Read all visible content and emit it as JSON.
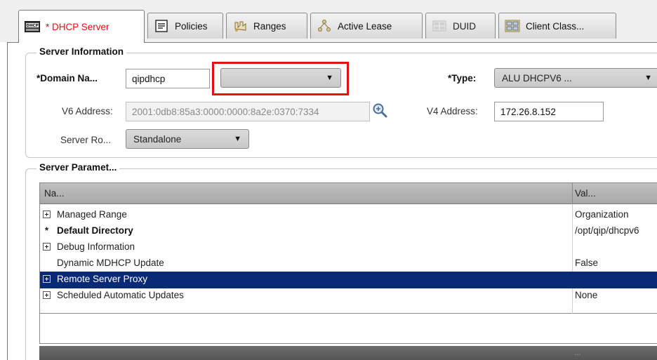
{
  "tabs": [
    {
      "id": "dhcp-server",
      "label": "* DHCP Server",
      "icon": "dhcp-server-icon",
      "active": true
    },
    {
      "id": "policies",
      "label": "Policies",
      "icon": "policies-icon"
    },
    {
      "id": "ranges",
      "label": "Ranges",
      "icon": "ranges-icon"
    },
    {
      "id": "active-lease",
      "label": "Active Lease",
      "icon": "active-lease-icon"
    },
    {
      "id": "duid",
      "label": "DUID",
      "icon": "duid-icon",
      "disabled": true
    },
    {
      "id": "client-class",
      "label": "Client Class...",
      "icon": "client-class-icon"
    }
  ],
  "server_info": {
    "title": "Server Information",
    "domain_label": "*Domain Na...",
    "domain_value": "qipdhcp",
    "domain_combo_value": "",
    "type_label": "*Type:",
    "type_value": "ALU DHCPV6 ...",
    "v6_label": "V6 Address:",
    "v6_value": "2001:0db8:85a3:0000:0000:8a2e:0370:7334",
    "v4_label": "V4 Address:",
    "v4_value": "172.26.8.152",
    "role_label": "Server Ro...",
    "role_value": "Standalone"
  },
  "server_params": {
    "title": "Server Paramet...",
    "columns": [
      "Na...",
      "Val..."
    ],
    "rows": [
      {
        "marker": "expand",
        "name": "Managed Range",
        "value": "Organization",
        "bold": false,
        "selected": false
      },
      {
        "marker": "star",
        "name": "Default Directory",
        "value": "/opt/qip/dhcpv6",
        "bold": true,
        "selected": false
      },
      {
        "marker": "expand",
        "name": "Debug Information",
        "value": "",
        "bold": false,
        "selected": false
      },
      {
        "marker": "none",
        "name": "Dynamic MDHCP Update",
        "value": "False",
        "bold": false,
        "selected": false
      },
      {
        "marker": "expand",
        "name": "Remote Server Proxy",
        "value": "",
        "bold": false,
        "selected": true
      },
      {
        "marker": "expand",
        "name": "Scheduled Automatic Updates",
        "value": "None",
        "bold": false,
        "selected": false
      }
    ],
    "footer_text": "..."
  },
  "colors": {
    "accent_highlight": "#e3120b",
    "selected_row": "#0a2a78",
    "active_tab_label": "#dd1111"
  }
}
